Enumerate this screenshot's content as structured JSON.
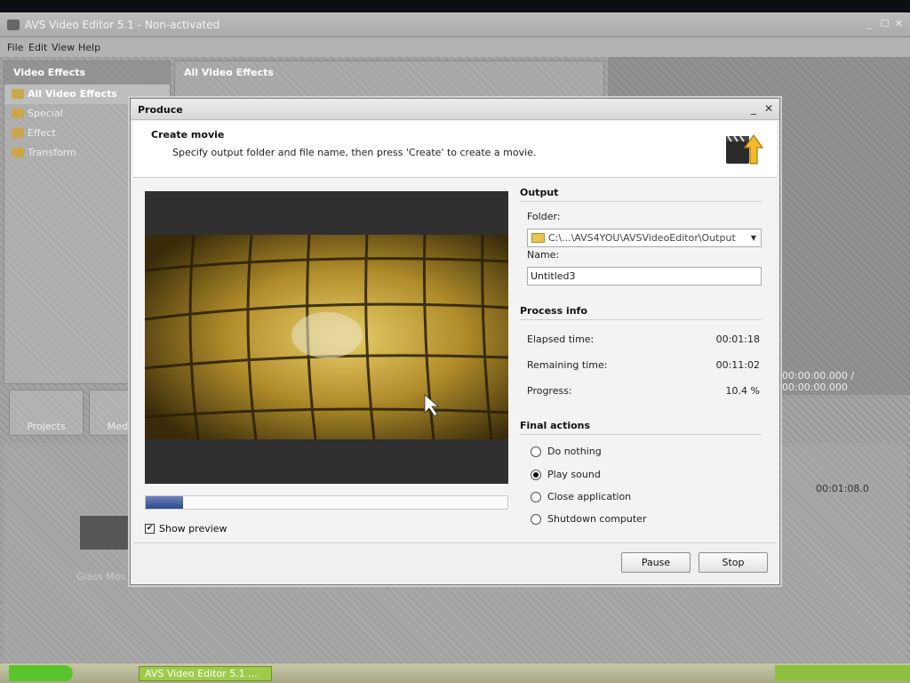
{
  "app": {
    "title": "AVS Video Editor 5.1 - Non-activated",
    "menu": [
      "File",
      "Edit",
      "View",
      "Help"
    ],
    "left_panel": {
      "header": "Video Effects",
      "items": [
        "All Video Effects",
        "Special",
        "Effect",
        "Transform"
      ]
    },
    "effects_panel": {
      "header": "All Video Effects"
    },
    "time_display": "00:00:00.000 / 00:00:00.000",
    "toolbar": {
      "projects_label": "Projects",
      "media_label": "Media L"
    },
    "timeline": {
      "clip_label": "Glass Mos",
      "time_marker": "00:01:08.0"
    },
    "taskbar": {
      "item_label": "AVS Video Editor 5.1 ..."
    }
  },
  "dialog": {
    "title": "Produce",
    "header": {
      "title": "Create movie",
      "subtitle": "Specify output folder and file name, then press 'Create' to create a movie."
    },
    "output": {
      "section_title": "Output",
      "folder_label": "Folder:",
      "folder_value": "C:\\...\\AVS4YOU\\AVSVideoEditor\\Output",
      "name_label": "Name:",
      "name_value": "Untitled3"
    },
    "process_info": {
      "section_title": "Process info",
      "elapsed_label": "Elapsed time:",
      "elapsed_value": "00:01:18",
      "remaining_label": "Remaining time:",
      "remaining_value": "00:11:02",
      "progress_label": "Progress:",
      "progress_value": "10.4 %",
      "progress_fraction": 0.104
    },
    "final_actions": {
      "section_title": "Final actions",
      "options": [
        {
          "label": "Do nothing",
          "selected": false
        },
        {
          "label": "Play sound",
          "selected": true
        },
        {
          "label": "Close application",
          "selected": false
        },
        {
          "label": "Shutdown computer",
          "selected": false
        }
      ]
    },
    "show_preview": {
      "label": "Show preview",
      "checked": true
    },
    "buttons": {
      "pause_label": "Pause",
      "stop_label": "Stop"
    }
  },
  "colors": {
    "progress_fill": "#2e4a8e",
    "preview_gold": "#c9a430",
    "dialog_bg": "#f0f0f0"
  }
}
